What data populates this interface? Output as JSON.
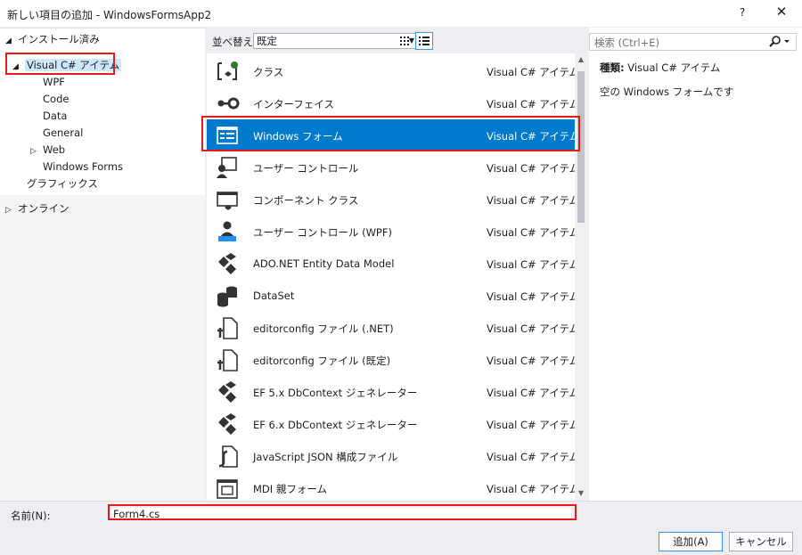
{
  "window": {
    "title": "新しい項目の追加 - WindowsFormsApp2",
    "help_label": "?",
    "close_label": "✕"
  },
  "tree": {
    "installed": "インストール済み",
    "visual_csharp": "Visual C# アイテム",
    "children": [
      "WPF",
      "Code",
      "Data",
      "General",
      "Web",
      "Windows Forms"
    ],
    "graphics": "グラフィックス",
    "online": "オンライン"
  },
  "toolbar": {
    "sort_label": "並べ替え:",
    "sort_value": "既定"
  },
  "items": [
    {
      "name": "クラス",
      "type": "Visual C# アイテム",
      "icon": "class-icon"
    },
    {
      "name": "インターフェイス",
      "type": "Visual C# アイテム",
      "icon": "interface-icon"
    },
    {
      "name": "Windows フォーム",
      "type": "Visual C# アイテム",
      "icon": "windows-form-icon"
    },
    {
      "name": "ユーザー コントロール",
      "type": "Visual C# アイテム",
      "icon": "user-control-icon"
    },
    {
      "name": "コンポーネント クラス",
      "type": "Visual C# アイテム",
      "icon": "component-class-icon"
    },
    {
      "name": "ユーザー コントロール (WPF)",
      "type": "Visual C# アイテム",
      "icon": "wpf-user-control-icon"
    },
    {
      "name": "ADO.NET Entity Data Model",
      "type": "Visual C# アイテム",
      "icon": "entity-model-icon"
    },
    {
      "name": "DataSet",
      "type": "Visual C# アイテム",
      "icon": "dataset-icon"
    },
    {
      "name": "editorconfig ファイル (.NET)",
      "type": "Visual C# アイテム",
      "icon": "config-file-icon"
    },
    {
      "name": "editorconfig ファイル (既定)",
      "type": "Visual C# アイテム",
      "icon": "config-file-icon"
    },
    {
      "name": "EF 5.x DbContext ジェネレーター",
      "type": "Visual C# アイテム",
      "icon": "ef-generator-icon"
    },
    {
      "name": "EF 6.x DbContext ジェネレーター",
      "type": "Visual C# アイテム",
      "icon": "ef-generator-icon"
    },
    {
      "name": "JavaScript JSON 構成ファイル",
      "type": "Visual C# アイテム",
      "icon": "json-config-icon"
    },
    {
      "name": "MDI 親フォーム",
      "type": "Visual C# アイテム",
      "icon": "mdi-form-icon"
    }
  ],
  "search": {
    "placeholder": "検索 (Ctrl+E)"
  },
  "details": {
    "type_key": "種類:",
    "type_value": "Visual C# アイテム",
    "description": "空の Windows フォームです"
  },
  "bottom": {
    "name_label": "名前(N):",
    "name_value": "Form4.cs",
    "add_button": "追加(A)",
    "cancel_button": "キャンセル"
  },
  "colors": {
    "selection": "#007acc",
    "highlight_box": "#e8191b",
    "tree_selection": "#cce8ff"
  }
}
